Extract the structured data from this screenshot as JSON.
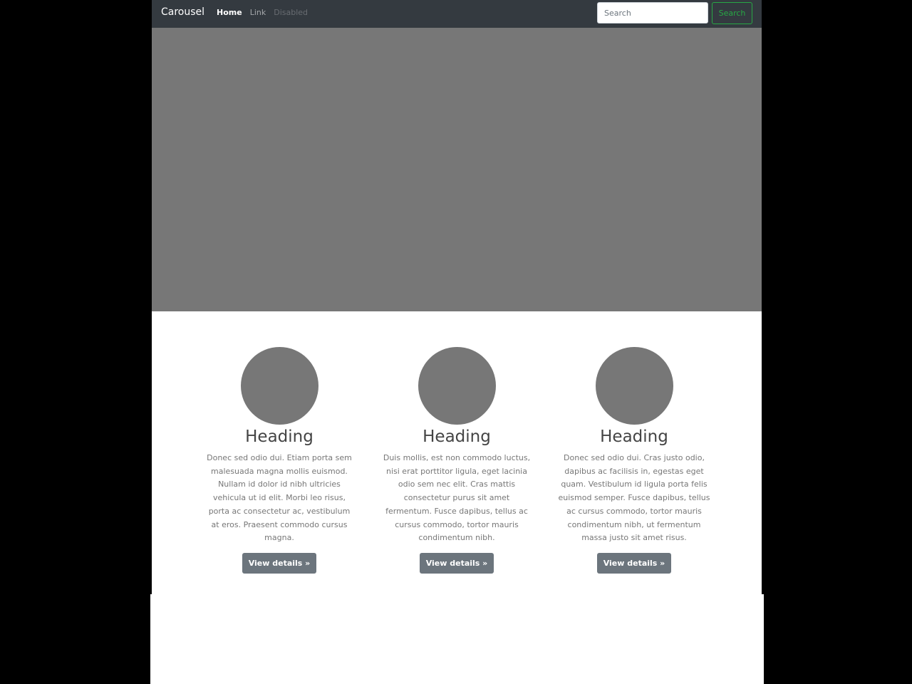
{
  "navbar": {
    "brand": "Carousel",
    "links": [
      "Home",
      "Link",
      "Disabled"
    ],
    "search_placeholder": "Search",
    "search_button": "Search"
  },
  "columns": [
    {
      "heading": "Heading",
      "text": "Donec sed odio dui. Etiam porta sem malesuada magna mollis euismod. Nullam id dolor id nibh ultricies vehicula ut id elit. Morbi leo risus, porta ac consectetur ac, vestibulum at eros. Praesent commodo cursus magna.",
      "button": "View details »"
    },
    {
      "heading": "Heading",
      "text": "Duis mollis, est non commodo luctus, nisi erat porttitor ligula, eget lacinia odio sem nec elit. Cras mattis consectetur purus sit amet fermentum. Fusce dapibus, tellus ac cursus commodo, tortor mauris condimentum nibh.",
      "button": "View details »"
    },
    {
      "heading": "Heading",
      "text": "Donec sed odio dui. Cras justo odio, dapibus ac facilisis in, egestas eget quam. Vestibulum id ligula porta felis euismod semper. Fusce dapibus, tellus ac cursus commodo, tortor mauris condimentum nibh, ut fermentum massa justo sit amet risus.",
      "button": "View details »"
    }
  ],
  "colors": {
    "navbar_bg": "#343a40",
    "placeholder_gray": "#777777",
    "success": "#28a745",
    "secondary": "#6c757d"
  }
}
